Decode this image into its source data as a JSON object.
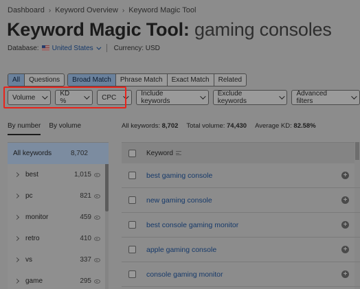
{
  "breadcrumb": [
    "Dashboard",
    "Keyword Overview",
    "Keyword Magic Tool"
  ],
  "title": {
    "tool": "Keyword Magic Tool:",
    "query": "gaming consoles"
  },
  "meta": {
    "database_label": "Database:",
    "database_value": "United States",
    "currency_label": "Currency: USD"
  },
  "tab_groups": {
    "questions": [
      "All",
      "Questions"
    ],
    "match": [
      "Broad Match",
      "Phrase Match",
      "Exact Match",
      "Related"
    ]
  },
  "filters": {
    "highlighted": [
      "Volume",
      "KD %",
      "CPC"
    ],
    "other": [
      "Include keywords",
      "Exclude keywords",
      "Advanced filters"
    ]
  },
  "sub_tabs": [
    "By number",
    "By volume"
  ],
  "stats": {
    "all_keywords_label": "All keywords:",
    "all_keywords_value": "8,702",
    "total_volume_label": "Total volume:",
    "total_volume_value": "74,430",
    "avg_kd_label": "Average KD:",
    "avg_kd_value": "82.58%"
  },
  "groups": {
    "all": {
      "name": "All keywords",
      "count": "8,702"
    },
    "items": [
      {
        "name": "best",
        "count": "1,015"
      },
      {
        "name": "pc",
        "count": "821"
      },
      {
        "name": "monitor",
        "count": "459"
      },
      {
        "name": "retro",
        "count": "410"
      },
      {
        "name": "vs",
        "count": "337"
      },
      {
        "name": "game",
        "count": "295"
      }
    ]
  },
  "table": {
    "header": "Keyword",
    "rows": [
      "best gaming console",
      "new gaming console",
      "best console gaming monitor",
      "apple gaming console",
      "console gaming monitor"
    ]
  },
  "colors": {
    "highlight": "#e8231b",
    "link": "#15396a",
    "active_tab": "#6a819c"
  }
}
